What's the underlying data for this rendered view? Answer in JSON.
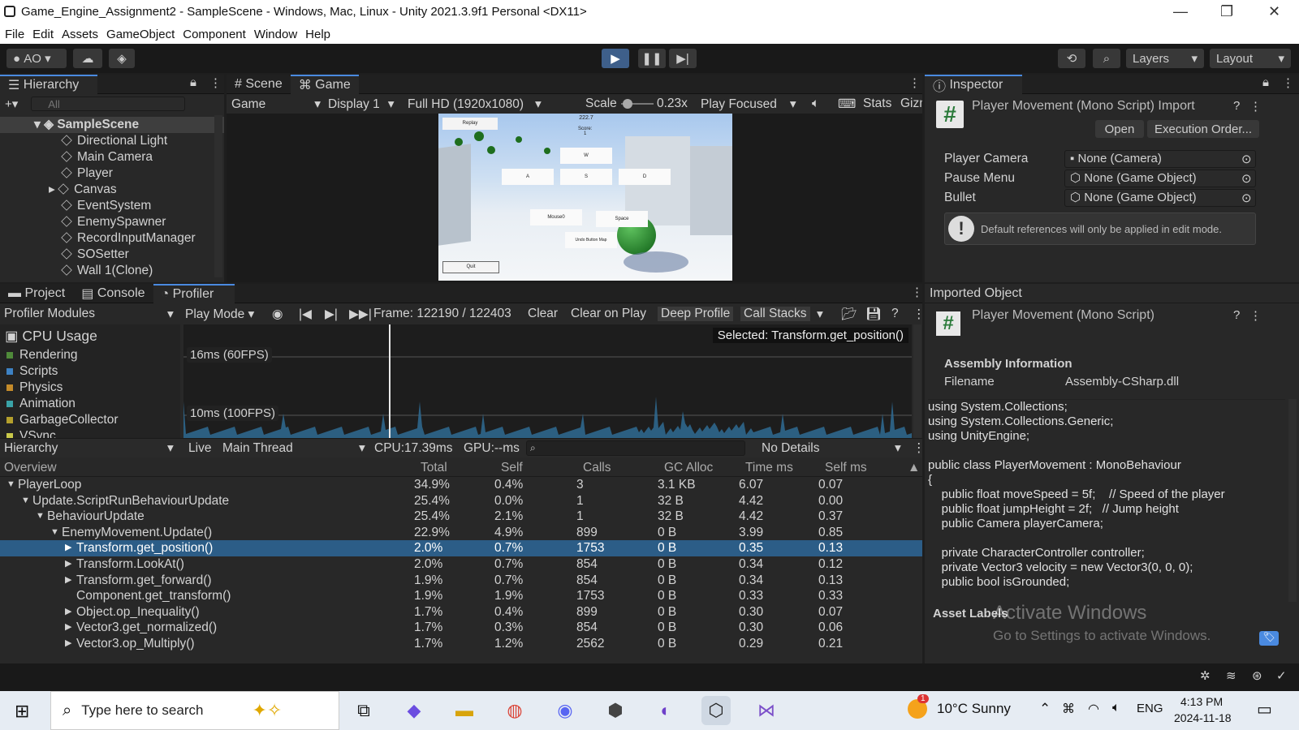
{
  "window": {
    "title": "Game_Engine_Assignment2 - SampleScene - Windows, Mac, Linux - Unity 2021.3.9f1 Personal <DX11>",
    "minimize": "—",
    "maximize": "❐",
    "close": "✕"
  },
  "menu": [
    "File",
    "Edit",
    "Assets",
    "GameObject",
    "Component",
    "Window",
    "Help"
  ],
  "toolbar": {
    "account": "AO",
    "layers": "Layers",
    "layout": "Layout"
  },
  "hierarchy": {
    "tab": "Hierarchy",
    "search_placeholder": "All",
    "scene": "SampleScene",
    "items": [
      "Directional Light",
      "Main Camera",
      "Player",
      "Canvas",
      "EventSystem",
      "EnemySpawner",
      "RecordInputManager",
      "SOSetter",
      "Wall 1(Clone)"
    ]
  },
  "game": {
    "tab_scene": "Scene",
    "tab_game": "Game",
    "mode": "Game",
    "display": "Display 1",
    "resolution": "Full HD (1920x1080)",
    "scale_label": "Scale",
    "scale_value": "0.23x",
    "play_focus": "Play Focused",
    "stats": "Stats",
    "gizmos": "Gizmos",
    "ui": {
      "replay": "Replay",
      "score_top": "222.7",
      "score_label": "Score:",
      "score_val": "1",
      "w": "W",
      "a": "A",
      "s": "S",
      "d": "D",
      "mouse": "Mouse0",
      "space": "Space",
      "undo": "Undo Button Map",
      "quit": "Quit"
    }
  },
  "inspector": {
    "tab": "Inspector",
    "title": "Player Movement (Mono Script) Import",
    "open": "Open",
    "exec": "Execution Order...",
    "fields": [
      {
        "label": "Player Camera",
        "value": "None (Camera)"
      },
      {
        "label": "Pause Menu",
        "value": "None (Game Object)"
      },
      {
        "label": "Bullet",
        "value": "None (Game Object)"
      }
    ],
    "info": "Default references will only be applied in edit mode.",
    "imported": "Imported Object",
    "script": "Player Movement (Mono Script)",
    "asm_title": "Assembly Information",
    "filename_label": "Filename",
    "filename": "Assembly-CSharp.dll",
    "code": [
      "using System.Collections;",
      "using System.Collections.Generic;",
      "using UnityEngine;",
      "",
      "public class PlayerMovement : MonoBehaviour",
      "{",
      "    public float moveSpeed = 5f;    // Speed of the player",
      "    public float jumpHeight = 2f;   // Jump height",
      "    public Camera playerCamera;",
      "",
      "    private CharacterController controller;",
      "    private Vector3 velocity = new Vector3(0, 0, 0);",
      "    public bool isGrounded;"
    ],
    "labels": "Asset Labels",
    "activate1": "Activate Windows",
    "activate2": "Go to Settings to activate Windows."
  },
  "bottom_tabs": {
    "project": "Project",
    "console": "Console",
    "profiler": "Profiler"
  },
  "profiler": {
    "modules": "Profiler Modules",
    "mode": "Play Mode",
    "frame": "Frame: 122190 / 122403",
    "clear": "Clear",
    "clear_on_play": "Clear on Play",
    "deep": "Deep Profile",
    "callstacks": "Call Stacks",
    "cpu": "CPU Usage",
    "cats": [
      {
        "n": "Rendering",
        "c": "#4f8a3a"
      },
      {
        "n": "Scripts",
        "c": "#3d82c4"
      },
      {
        "n": "Physics",
        "c": "#c48b2a"
      },
      {
        "n": "Animation",
        "c": "#3aa3a8"
      },
      {
        "n": "GarbageCollector",
        "c": "#b4a02c"
      },
      {
        "n": "VSync",
        "c": "#c8c84a"
      }
    ],
    "selected": "Selected: Transform.get_position()",
    "line16": "16ms (60FPS)",
    "line10": "10ms (100FPS)",
    "view": "Hierarchy",
    "live": "Live",
    "thread": "Main Thread",
    "cpu_time": "CPU:17.39ms",
    "gpu_time": "GPU:--ms",
    "details": "No Details",
    "cols": [
      "Overview",
      "Total",
      "Self",
      "Calls",
      "GC Alloc",
      "Time ms",
      "Self ms"
    ],
    "rows": [
      {
        "n": "PlayerLoop",
        "ind": 0,
        "arrow": "▼",
        "t": "34.9%",
        "s": "0.4%",
        "c": "3",
        "g": "3.1 KB",
        "tm": "6.07",
        "sm": "0.07"
      },
      {
        "n": "Update.ScriptRunBehaviourUpdate",
        "ind": 1,
        "arrow": "▼",
        "t": "25.4%",
        "s": "0.0%",
        "c": "1",
        "g": "32 B",
        "tm": "4.42",
        "sm": "0.00"
      },
      {
        "n": "BehaviourUpdate",
        "ind": 2,
        "arrow": "▼",
        "t": "25.4%",
        "s": "2.1%",
        "c": "1",
        "g": "32 B",
        "tm": "4.42",
        "sm": "0.37"
      },
      {
        "n": "EnemyMovement.Update()",
        "ind": 3,
        "arrow": "▼",
        "t": "22.9%",
        "s": "4.9%",
        "c": "899",
        "g": "0 B",
        "tm": "3.99",
        "sm": "0.85"
      },
      {
        "n": "Transform.get_position()",
        "ind": 4,
        "arrow": "▶",
        "t": "2.0%",
        "s": "0.7%",
        "c": "1753",
        "g": "0 B",
        "tm": "0.35",
        "sm": "0.13",
        "sel": true
      },
      {
        "n": "Transform.LookAt()",
        "ind": 4,
        "arrow": "▶",
        "t": "2.0%",
        "s": "0.7%",
        "c": "854",
        "g": "0 B",
        "tm": "0.34",
        "sm": "0.12"
      },
      {
        "n": "Transform.get_forward()",
        "ind": 4,
        "arrow": "▶",
        "t": "1.9%",
        "s": "0.7%",
        "c": "854",
        "g": "0 B",
        "tm": "0.34",
        "sm": "0.13"
      },
      {
        "n": "Component.get_transform()",
        "ind": 4,
        "arrow": "",
        "t": "1.9%",
        "s": "1.9%",
        "c": "1753",
        "g": "0 B",
        "tm": "0.33",
        "sm": "0.33"
      },
      {
        "n": "Object.op_Inequality()",
        "ind": 4,
        "arrow": "▶",
        "t": "1.7%",
        "s": "0.4%",
        "c": "899",
        "g": "0 B",
        "tm": "0.30",
        "sm": "0.07"
      },
      {
        "n": "Vector3.get_normalized()",
        "ind": 4,
        "arrow": "▶",
        "t": "1.7%",
        "s": "0.3%",
        "c": "854",
        "g": "0 B",
        "tm": "0.30",
        "sm": "0.06"
      },
      {
        "n": "Vector3.op_Multiply()",
        "ind": 4,
        "arrow": "▶",
        "t": "1.7%",
        "s": "1.2%",
        "c": "2562",
        "g": "0 B",
        "tm": "0.29",
        "sm": "0.21"
      }
    ]
  },
  "taskbar": {
    "search": "Type here to search",
    "weather": "10°C  Sunny",
    "lang": "ENG",
    "time": "4:13 PM",
    "date": "2024-11-18",
    "badge": "1"
  }
}
